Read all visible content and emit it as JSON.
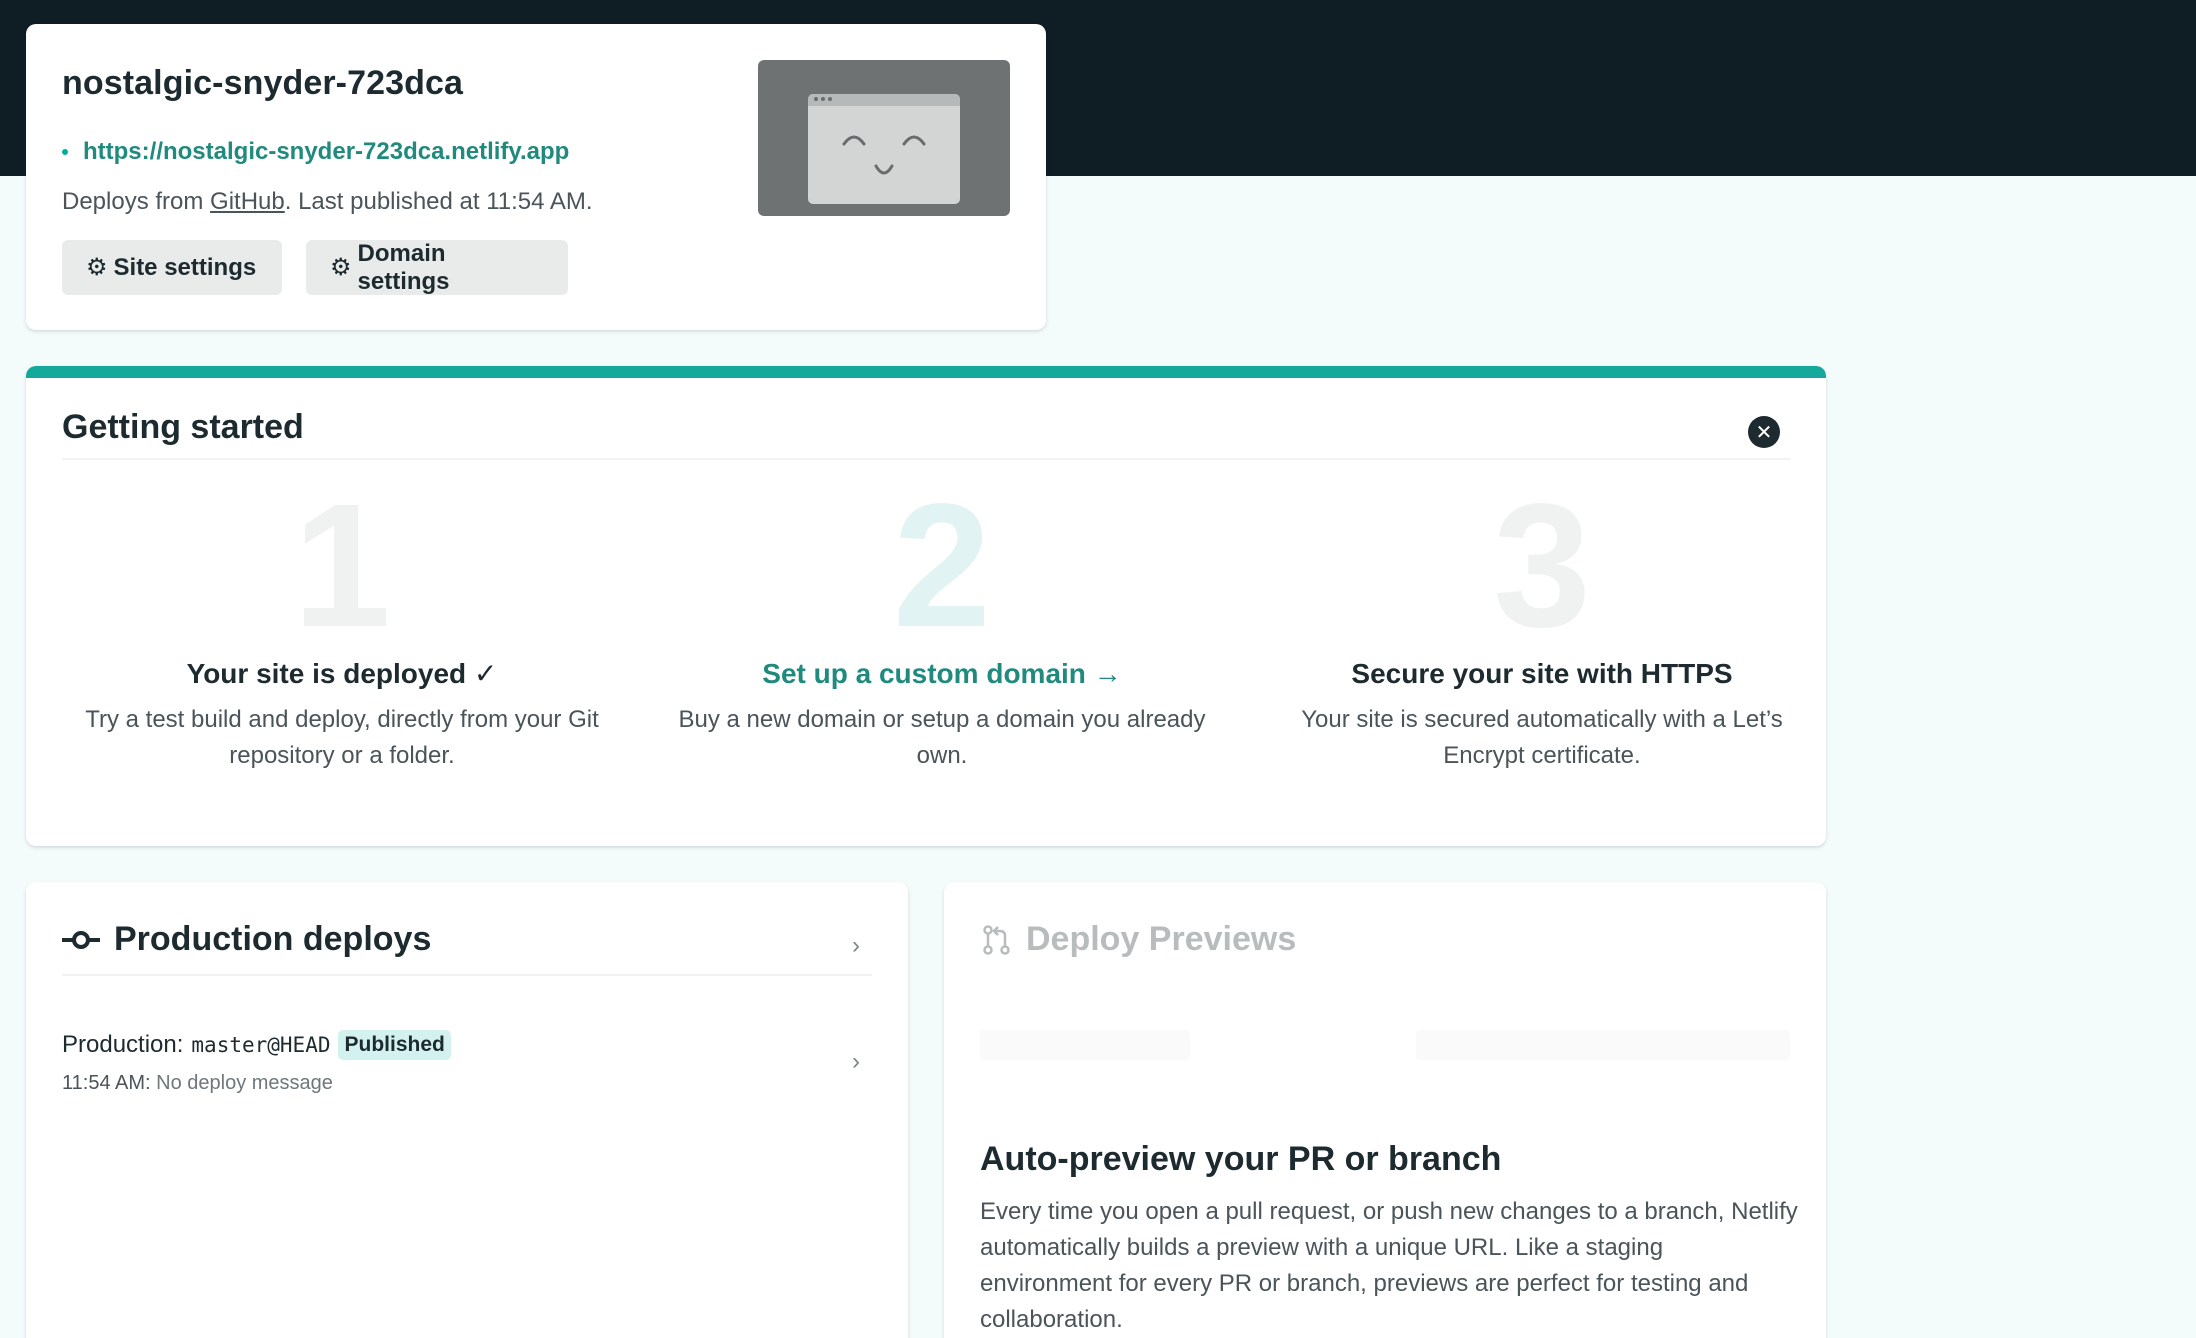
{
  "site": {
    "name": "nostalgic-snyder-723dca",
    "url": "https://nostalgic-snyder-723dca.netlify.app",
    "deploys_prefix": "Deploys from ",
    "deploys_source": "GitHub",
    "deploys_suffix": ". Last published at 11:54 AM.",
    "buttons": {
      "site_settings": "Site settings",
      "domain_settings": "Domain settings"
    },
    "thumbnail_icon": "smiling-browser-window"
  },
  "getting_started": {
    "title": "Getting started",
    "close_icon": "close-circle-icon",
    "steps": [
      {
        "number": "1",
        "title": "Your site is deployed ✓",
        "description": "Try a test build and deploy, directly from your Git repository or a folder."
      },
      {
        "number": "2",
        "title": "Set up a custom domain →",
        "description": "Buy a new domain or setup a domain you already own."
      },
      {
        "number": "3",
        "title": "Secure your site with HTTPS",
        "description": "Your site is secured automatically with a Let’s Encrypt certificate."
      }
    ]
  },
  "production_deploys": {
    "title": "Production deploys",
    "icon": "commit-icon",
    "deploy": {
      "label": "Production:",
      "ref": "master@HEAD",
      "status": "Published",
      "time": "11:54 AM:",
      "message": "No deploy message"
    }
  },
  "deploy_previews": {
    "title": "Deploy Previews",
    "icon": "pull-request-icon",
    "heading": "Auto-preview your PR or branch",
    "description": "Every time you open a pull request, or push new changes to a branch, Netlify automatically builds a preview with a unique URL. Like a staging environment for every PR or branch, previews are perfect for testing and collaboration."
  },
  "colors": {
    "header_bg": "#0f1e25",
    "page_bg": "#f4fbfb",
    "accent": "#15a99b",
    "link": "#1f8a7d",
    "badge_bg": "#d3f2ef"
  }
}
